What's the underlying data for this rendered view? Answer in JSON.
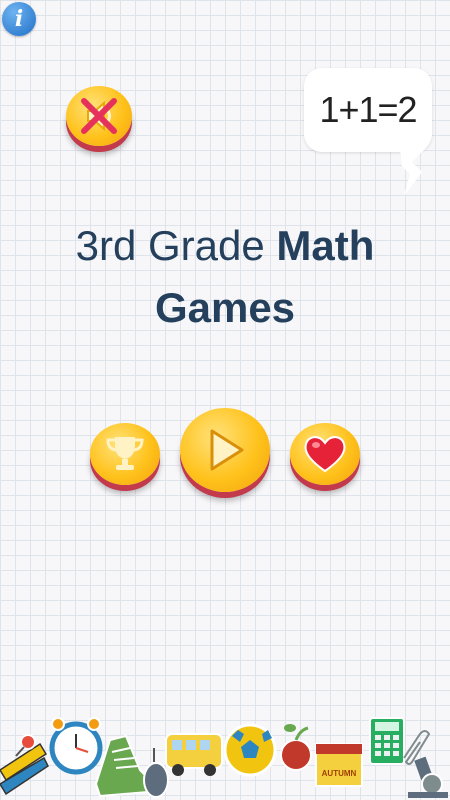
{
  "info_button": {
    "glyph": "i",
    "icon": "info-icon"
  },
  "sound_button": {
    "icon": "sound-off-icon",
    "state": "muted"
  },
  "speech_bubble": {
    "text": "1+1=2"
  },
  "title": {
    "line1_regular": "3rd Grade ",
    "line1_bold": "Math",
    "line2": "Games"
  },
  "menu": {
    "leaderboard": {
      "icon": "trophy-icon"
    },
    "play": {
      "icon": "play-icon"
    },
    "rate": {
      "icon": "heart-icon"
    }
  },
  "decor_text": {
    "autumn": "AUTUMN"
  },
  "colors": {
    "button_yellow": "#ffc21c",
    "button_rim": "#c23a4c",
    "title": "#24405c",
    "info_blue": "#1e6fc8"
  }
}
